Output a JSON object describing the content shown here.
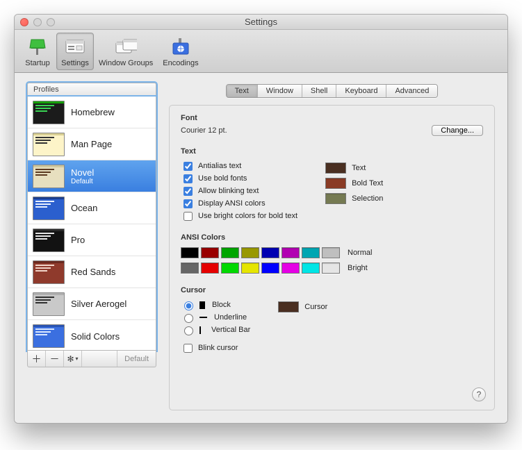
{
  "window": {
    "title": "Settings"
  },
  "toolbar": {
    "items": [
      {
        "label": "Startup"
      },
      {
        "label": "Settings"
      },
      {
        "label": "Window Groups"
      },
      {
        "label": "Encodings"
      }
    ]
  },
  "profiles": {
    "header": "Profiles",
    "items": [
      {
        "name": "Homebrew",
        "thumb_bg": "#1b1b1b",
        "thumb_bar": "#16a00b",
        "thumb_txt": "#39d353"
      },
      {
        "name": "Man Page",
        "thumb_bg": "#fdf4c8",
        "thumb_bar": "#d8cf94",
        "thumb_txt": "#333"
      },
      {
        "name": "Novel",
        "sub": "Default",
        "thumb_bg": "#e7dfbf",
        "thumb_bar": "#cfc79e",
        "thumb_txt": "#5b3a21",
        "selected": true
      },
      {
        "name": "Ocean",
        "thumb_bg": "#2b5fce",
        "thumb_bar": "#1c3f8f",
        "thumb_txt": "#e8f0ff"
      },
      {
        "name": "Pro",
        "thumb_bg": "#121212",
        "thumb_bar": "#2a2a2a",
        "thumb_txt": "#e6e6e6"
      },
      {
        "name": "Red Sands",
        "thumb_bg": "#8f3a2c",
        "thumb_bar": "#6b2a20",
        "thumb_txt": "#f2d4c8"
      },
      {
        "name": "Silver Aerogel",
        "thumb_bg": "#c9c9c9",
        "thumb_bar": "#b0b0b0",
        "thumb_txt": "#303030"
      },
      {
        "name": "Solid Colors",
        "thumb_bg": "#3b6fe0",
        "thumb_bar": "#2a54b2",
        "thumb_txt": "#dbe8ff"
      }
    ],
    "footer_default": "Default"
  },
  "tabs": [
    "Text",
    "Window",
    "Shell",
    "Keyboard",
    "Advanced"
  ],
  "font": {
    "title": "Font",
    "desc": "Courier 12 pt.",
    "change": "Change..."
  },
  "text": {
    "title": "Text",
    "opts": {
      "antialias": "Antialias text",
      "bold": "Use bold fonts",
      "blink": "Allow blinking text",
      "ansi": "Display ANSI colors",
      "bright": "Use bright colors for bold text"
    },
    "swatches": {
      "text_label": "Text",
      "text_color": "#4a2f21",
      "bold_label": "Bold Text",
      "bold_color": "#8a3b25",
      "sel_label": "Selection",
      "sel_color": "#757a52"
    }
  },
  "ansi": {
    "title": "ANSI Colors",
    "normal_label": "Normal",
    "bright_label": "Bright",
    "normal": [
      "#000000",
      "#990000",
      "#00a600",
      "#999900",
      "#0000b2",
      "#b200b2",
      "#00a6b2",
      "#bfbfbf"
    ],
    "bright": [
      "#666666",
      "#e50000",
      "#00d900",
      "#e5e500",
      "#0000ff",
      "#e500e5",
      "#00e5e5",
      "#e5e5e5"
    ]
  },
  "cursor": {
    "title": "Cursor",
    "block": "Block",
    "underline": "Underline",
    "vbar": "Vertical Bar",
    "blink": "Blink cursor",
    "swatch_label": "Cursor",
    "swatch_color": "#4a2f21"
  }
}
